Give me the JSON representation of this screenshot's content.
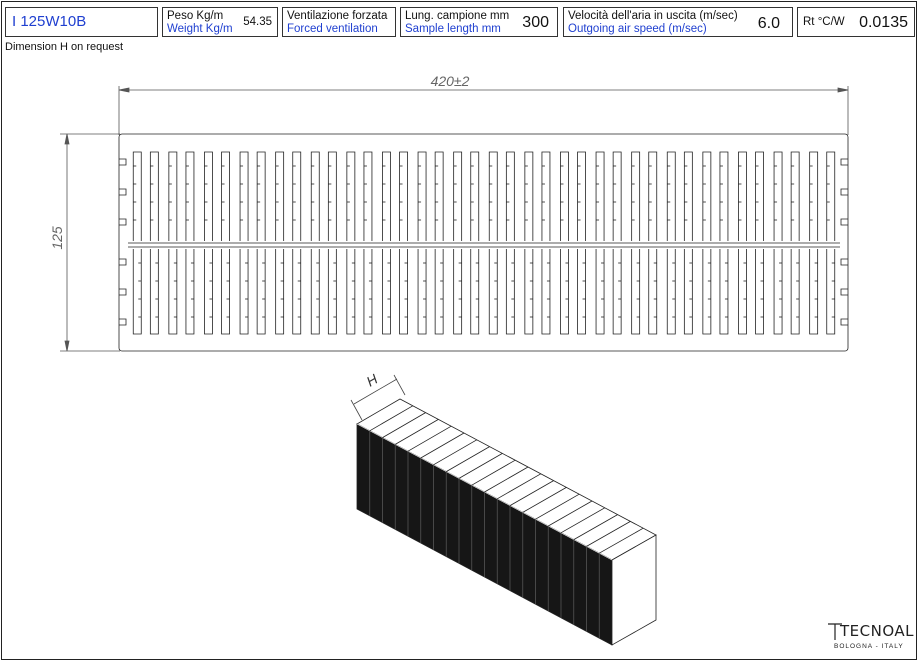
{
  "header": {
    "code": "I 125W10B",
    "weight": {
      "label_it": "Peso Kg/m",
      "label_en": "Weight Kg/m",
      "value": "54.35"
    },
    "ventilation": {
      "label_it": "Ventilazione forzata",
      "label_en": "Forced ventilation"
    },
    "sample_length": {
      "label_it": "Lung. campione mm",
      "label_en": "Sample length mm",
      "value": "300"
    },
    "air_speed": {
      "label_it": "Velocità dell'aria in uscita (m/sec)",
      "label_en": "Outgoing air speed (m/sec)",
      "value": "6.0"
    },
    "thermal_resistance": {
      "label": "Rt °C/W",
      "value": "0.0135"
    }
  },
  "note": "Dimension H on request",
  "drawing": {
    "width_dim": "420±2",
    "height_dim": "125",
    "iso_dim": "H",
    "fin_pairs": 20
  },
  "logo": {
    "name": "TECNOAL",
    "city": "BOLOGNA - ITALY"
  },
  "colors": {
    "accent_blue": "#1f3fd0",
    "line": "#222222"
  }
}
